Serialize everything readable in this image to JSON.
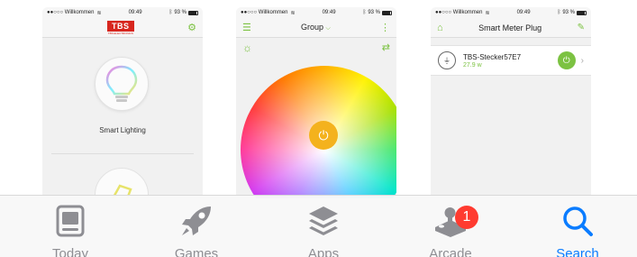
{
  "status_bar": {
    "carrier": "●●○○○ Willkommen",
    "time": "09:49",
    "battery": "93 %"
  },
  "screen1": {
    "logo": "TBS",
    "logo_sub": "TBS ELECTRONICS",
    "item_label": "Smart Lighting"
  },
  "screen2": {
    "title": "Group",
    "title_chevron": "⌵"
  },
  "screen3": {
    "title": "Smart Meter Plug",
    "device_name": "TBS-Stecker57E7",
    "device_power": "27.9 w"
  },
  "tab_bar": {
    "tabs": [
      {
        "label": "Today",
        "icon": "today-icon",
        "active": false
      },
      {
        "label": "Games",
        "icon": "rocket-icon",
        "active": false
      },
      {
        "label": "Apps",
        "icon": "layers-icon",
        "active": false
      },
      {
        "label": "Arcade",
        "icon": "joystick-icon",
        "active": false,
        "badge": "1"
      },
      {
        "label": "Search",
        "icon": "search-icon",
        "active": true
      }
    ]
  },
  "colors": {
    "accent_blue": "#0a7cff",
    "badge_red": "#ff3b30",
    "tbs_red": "#d7261e",
    "app_green": "#7cc242",
    "power_yellow": "#f4b21d"
  }
}
